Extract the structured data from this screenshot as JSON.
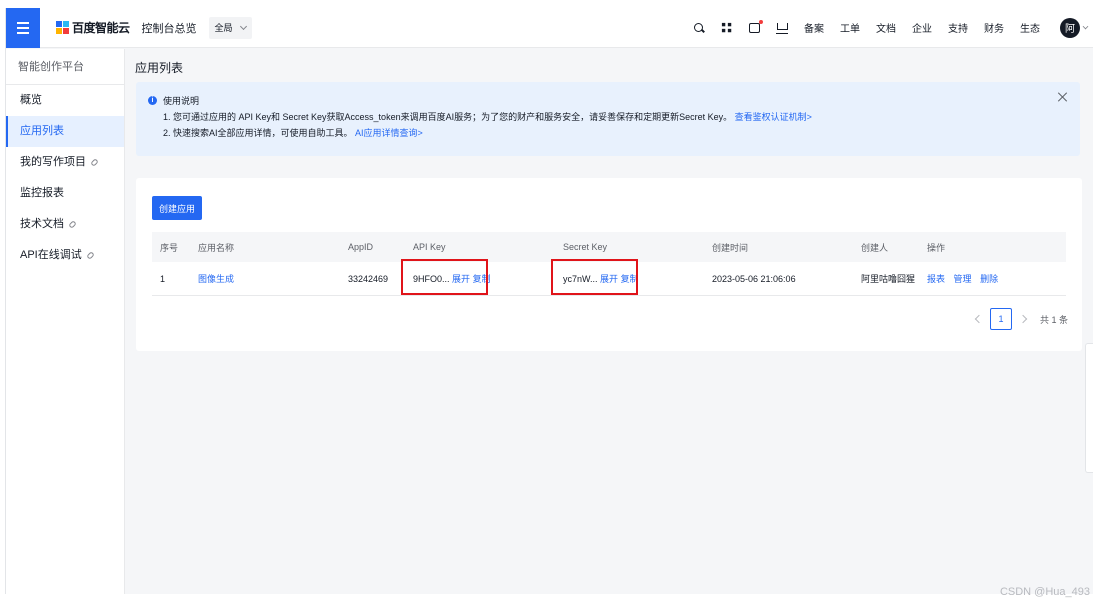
{
  "topbar": {
    "logo_text": "百度智能云",
    "console_home": "控制台总览",
    "scope": "全局",
    "nav": [
      "备案",
      "工单",
      "文档",
      "企业",
      "支持",
      "财务",
      "生态"
    ],
    "avatar": "阿",
    "icons": [
      "search-icon",
      "grid-icon",
      "message-icon",
      "cart-icon"
    ]
  },
  "sidebar": {
    "title": "智能创作平台",
    "items": [
      {
        "label": "概览",
        "active": false,
        "link": false
      },
      {
        "label": "应用列表",
        "active": true,
        "link": false
      },
      {
        "label": "我的写作项目",
        "active": false,
        "link": true
      },
      {
        "label": "监控报表",
        "active": false,
        "link": false
      },
      {
        "label": "技术文档",
        "active": false,
        "link": true
      },
      {
        "label": "API在线调试",
        "active": false,
        "link": true
      }
    ]
  },
  "main": {
    "page_title": "应用列表",
    "notice": {
      "title": "使用说明",
      "line1": "1. 您可通过应用的 API Key和 Secret Key获取Access_token来调用百度AI服务；为了您的财产和服务安全，请妥善保存和定期更新Secret Key。",
      "line1_link": "查看鉴权认证机制>",
      "line2": "2. 快速搜索AI全部应用详情，可使用自助工具。",
      "line2_link": "AI应用详情查询>"
    },
    "create_button": "创建应用",
    "table": {
      "headers": [
        "序号",
        "应用名称",
        "AppID",
        "API Key",
        "Secret Key",
        "创建时间",
        "创建人",
        "操作"
      ],
      "rows": [
        {
          "index": "1",
          "name": "图像生成",
          "appid": "33242469",
          "api_key": "9HFO0...",
          "secret_key": "yc7nW...",
          "created": "2023-05-06 21:06:06",
          "creator": "阿里咕噜囧猩",
          "expand": "展开",
          "copy": "复制",
          "ops": [
            "报表",
            "管理",
            "删除"
          ]
        }
      ]
    },
    "pager": {
      "current": "1",
      "total": "共 1 条"
    }
  },
  "watermark": "CSDN @Hua_493",
  "colors": {
    "accent": "#2468f2",
    "highlight": "#e0141a",
    "notice_bg": "#e8f1fd"
  }
}
